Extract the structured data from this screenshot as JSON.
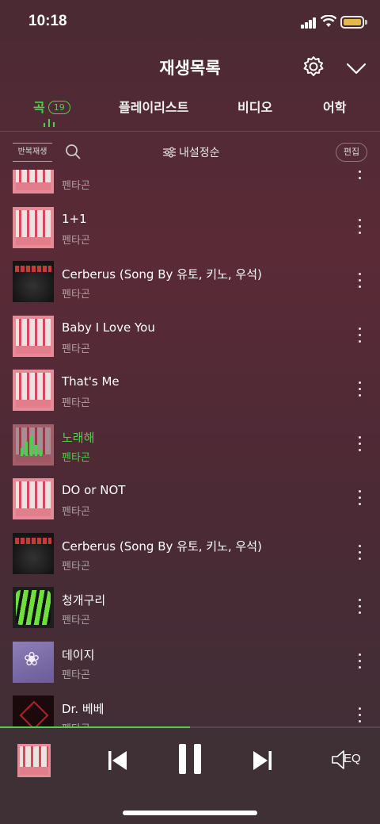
{
  "status_bar": {
    "time": "10:18"
  },
  "header": {
    "title": "재생목록"
  },
  "tabs": [
    {
      "label": "곡",
      "badge": "19",
      "active": true
    },
    {
      "label": "플레이리스트",
      "active": false
    },
    {
      "label": "비디오",
      "active": false
    },
    {
      "label": "어학",
      "active": false
    }
  ],
  "toolbar": {
    "repeat_label": "반복재생",
    "sort_label": "내설정순",
    "edit_label": "편집"
  },
  "songs": [
    {
      "title": "",
      "artist": "펜타곤",
      "art": "pink"
    },
    {
      "title": "1+1",
      "artist": "펜타곤",
      "art": "pink"
    },
    {
      "title": "Cerberus (Song By 유토, 키노, 우석)",
      "artist": "펜타곤",
      "art": "dark"
    },
    {
      "title": "Baby I Love You",
      "artist": "펜타곤",
      "art": "pink"
    },
    {
      "title": "That's Me",
      "artist": "펜타곤",
      "art": "pink"
    },
    {
      "title": "노래해",
      "artist": "펜타곤",
      "art": "pink",
      "playing": true
    },
    {
      "title": "DO or NOT",
      "artist": "펜타곤",
      "art": "pink"
    },
    {
      "title": "Cerberus (Song By 유토, 키노, 우석)",
      "artist": "펜타곤",
      "art": "dark"
    },
    {
      "title": "청개구리",
      "artist": "펜타곤",
      "art": "green"
    },
    {
      "title": "데이지",
      "artist": "펜타곤",
      "art": "purple"
    },
    {
      "title": "Dr. 베베",
      "artist": "펜타곤",
      "art": "red"
    }
  ],
  "player": {
    "progress": 0.5,
    "eq_label": "EQ"
  },
  "colors": {
    "accent": "#4ad34a",
    "background": "#4a2a33",
    "player_bg": "#3f3035"
  }
}
